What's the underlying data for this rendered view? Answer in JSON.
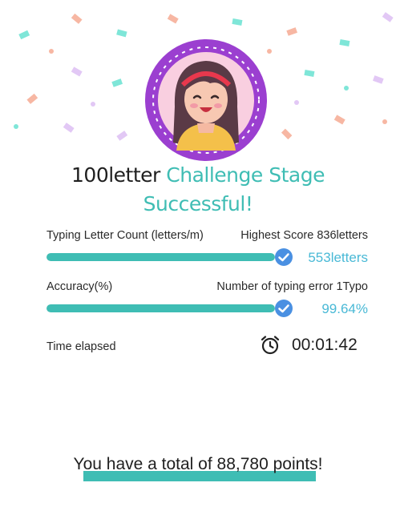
{
  "result": {
    "title_prefix": "100letter",
    "title_highlight": "Challenge Stage",
    "title_second_line": "Successful!"
  },
  "stats": {
    "typing_count": {
      "label": "Typing Letter Count (letters/m)",
      "best_label": "Highest Score 836letters",
      "value": "553letters",
      "progress": 1.0
    },
    "accuracy": {
      "label": "Accuracy(%)",
      "error_label": "Number of typing error 1Typo",
      "value": "99.64%",
      "progress": 1.0
    },
    "elapsed": {
      "label": "Time elapsed",
      "value": "00:01:42"
    }
  },
  "total": {
    "text": "You have a total of 88,780 points!"
  },
  "icons": {
    "avatar": "girl-avatar-icon",
    "check": "check-circle-icon",
    "clock": "alarm-clock-icon"
  },
  "colors": {
    "accent_teal": "#3fbdb4",
    "value_blue": "#49b9d6",
    "check_blue": "#4a90e2",
    "avatar_ring": "#9b3fd0",
    "avatar_bg": "#f9cfe0"
  }
}
